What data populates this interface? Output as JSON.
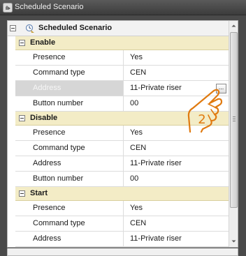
{
  "window": {
    "title": "Scheduled Scenario"
  },
  "root": {
    "label": "Scheduled Scenario"
  },
  "categories": [
    {
      "label": "Enable",
      "properties": [
        {
          "name": "Presence",
          "value": "Yes"
        },
        {
          "name": "Command type",
          "value": "CEN"
        },
        {
          "name": "Address",
          "value": "11-Private riser"
        },
        {
          "name": "Button number",
          "value": "00"
        }
      ]
    },
    {
      "label": "Disable",
      "properties": [
        {
          "name": "Presence",
          "value": "Yes"
        },
        {
          "name": "Command type",
          "value": "CEN"
        },
        {
          "name": "Address",
          "value": "11-Private riser"
        },
        {
          "name": "Button number",
          "value": "00"
        }
      ]
    },
    {
      "label": "Start",
      "properties": [
        {
          "name": "Presence",
          "value": "Yes"
        },
        {
          "name": "Command type",
          "value": "CEN"
        },
        {
          "name": "Address",
          "value": "11-Private riser"
        }
      ]
    }
  ],
  "ellipsis_button": {
    "label": "..."
  },
  "callout": {
    "number": "2"
  },
  "colors": {
    "title_bar": "#4a4a4a",
    "category_band": "#f3ecc6",
    "selected_name_cell": "#d6d6d6",
    "callout_accent": "#e07a10"
  },
  "icons": {
    "title_bar": "scenario-app-icon",
    "root": "scheduled-scenario-icon",
    "callout": "pointing-hand-icon"
  }
}
